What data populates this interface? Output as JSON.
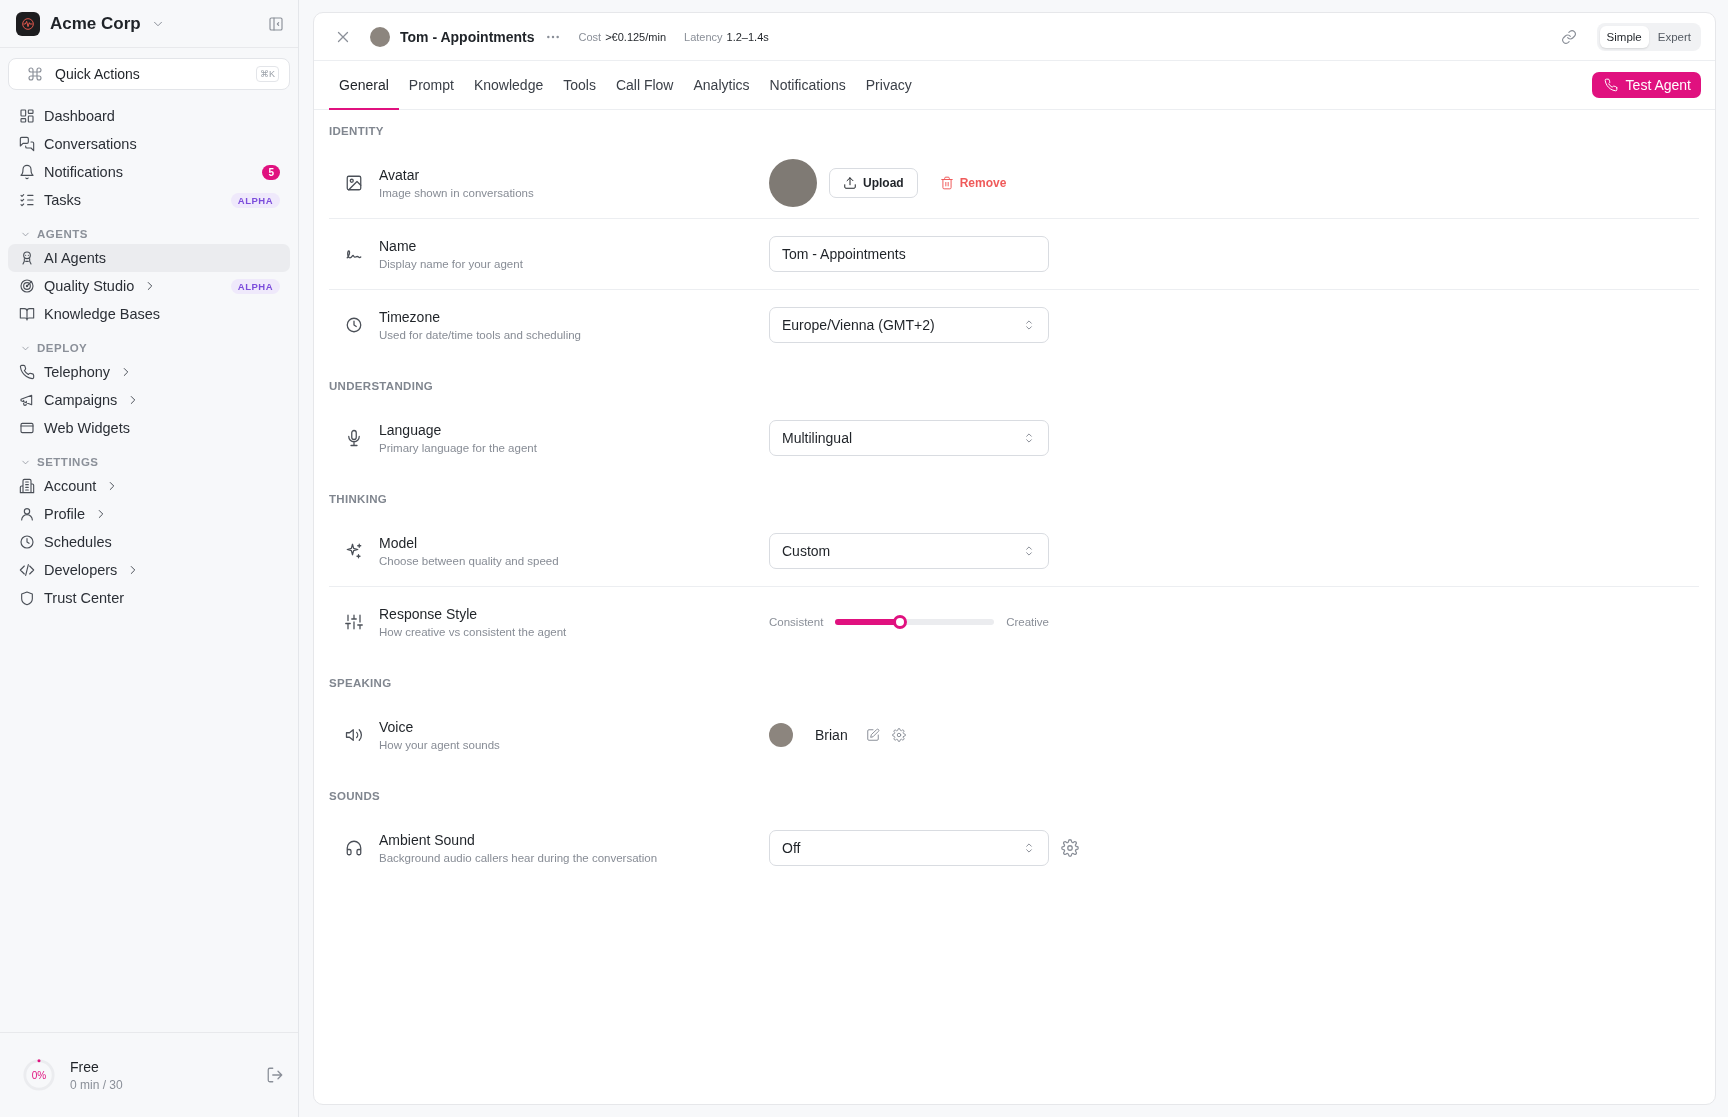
{
  "sidebar": {
    "org_name": "Acme Corp",
    "quick_actions": {
      "label": "Quick Actions",
      "shortcut": "⌘K"
    },
    "top_items": [
      {
        "label": "Dashboard",
        "selected": false,
        "has_submenu": false
      },
      {
        "label": "Conversations",
        "selected": false,
        "has_submenu": false
      },
      {
        "label": "Notifications",
        "selected": false,
        "has_submenu": false,
        "badge": {
          "text": "5",
          "kind": "count"
        }
      },
      {
        "label": "Tasks",
        "selected": false,
        "has_submenu": false,
        "badge": {
          "text": "ALPHA",
          "kind": "tag"
        }
      }
    ],
    "sections": [
      {
        "title": "AGENTS",
        "expanded": true,
        "items": [
          {
            "label": "AI Agents",
            "selected": true,
            "has_submenu": false
          },
          {
            "label": "Quality Studio",
            "selected": false,
            "has_submenu": true,
            "badge": {
              "text": "ALPHA",
              "kind": "tag"
            }
          },
          {
            "label": "Knowledge Bases",
            "selected": false,
            "has_submenu": false
          }
        ]
      },
      {
        "title": "DEPLOY",
        "expanded": true,
        "items": [
          {
            "label": "Telephony",
            "selected": false,
            "has_submenu": true
          },
          {
            "label": "Campaigns",
            "selected": false,
            "has_submenu": true
          },
          {
            "label": "Web Widgets",
            "selected": false,
            "has_submenu": false
          }
        ]
      },
      {
        "title": "SETTINGS",
        "expanded": true,
        "items": [
          {
            "label": "Account",
            "selected": false,
            "has_submenu": true
          },
          {
            "label": "Profile",
            "selected": false,
            "has_submenu": true
          },
          {
            "label": "Schedules",
            "selected": false,
            "has_submenu": false
          },
          {
            "label": "Developers",
            "selected": false,
            "has_submenu": true
          },
          {
            "label": "Trust Center",
            "selected": false,
            "has_submenu": false
          }
        ]
      }
    ],
    "plan": {
      "name": "Free",
      "usage": "0 min / 30",
      "percent": "0%",
      "level": 0
    }
  },
  "header": {
    "title": "Tom - Appointments",
    "cost_label": "Cost",
    "cost_value": ">€0.125/min",
    "latency_label": "Latency",
    "latency_value": "1.2–1.4s",
    "modes": [
      {
        "label": "Simple",
        "selected": true
      },
      {
        "label": "Expert",
        "selected": false
      }
    ]
  },
  "tabs": [
    {
      "label": "General",
      "selected": true
    },
    {
      "label": "Prompt",
      "selected": false
    },
    {
      "label": "Knowledge",
      "selected": false
    },
    {
      "label": "Tools",
      "selected": false
    },
    {
      "label": "Call Flow",
      "selected": false
    },
    {
      "label": "Analytics",
      "selected": false
    },
    {
      "label": "Notifications",
      "selected": false
    },
    {
      "label": "Privacy",
      "selected": false
    }
  ],
  "test_button": "Test Agent",
  "form_sections": [
    {
      "title": "IDENTITY",
      "rows": [
        {
          "kind": "avatar",
          "label": "Avatar",
          "description": "Image shown in conversations",
          "upload": "Upload",
          "remove": "Remove"
        },
        {
          "kind": "text",
          "label": "Name",
          "description": "Display name for your agent",
          "value": "Tom - Appointments"
        },
        {
          "kind": "select",
          "label": "Timezone",
          "description": "Used for date/time tools and scheduling",
          "value": "Europe/Vienna (GMT+2)",
          "has_settings": false
        }
      ]
    },
    {
      "title": "UNDERSTANDING",
      "rows": [
        {
          "kind": "select",
          "label": "Language",
          "description": "Primary language for the agent",
          "value": "Multilingual",
          "has_settings": false
        }
      ]
    },
    {
      "title": "THINKING",
      "rows": [
        {
          "kind": "select",
          "label": "Model",
          "description": "Choose between quality and speed",
          "value": "Custom",
          "has_settings": false
        },
        {
          "kind": "slider",
          "label": "Response Style",
          "description": "How creative vs consistent the agent",
          "left_label": "Consistent",
          "right_label": "Creative",
          "level": 0.41
        }
      ]
    },
    {
      "title": "SPEAKING",
      "rows": [
        {
          "kind": "voice",
          "label": "Voice",
          "description": "How your agent sounds",
          "value": "Brian"
        }
      ]
    },
    {
      "title": "SOUNDS",
      "rows": [
        {
          "kind": "select",
          "label": "Ambient Sound",
          "description": "Background audio callers hear during the conversation",
          "value": "Off",
          "has_settings": true
        }
      ]
    }
  ]
}
